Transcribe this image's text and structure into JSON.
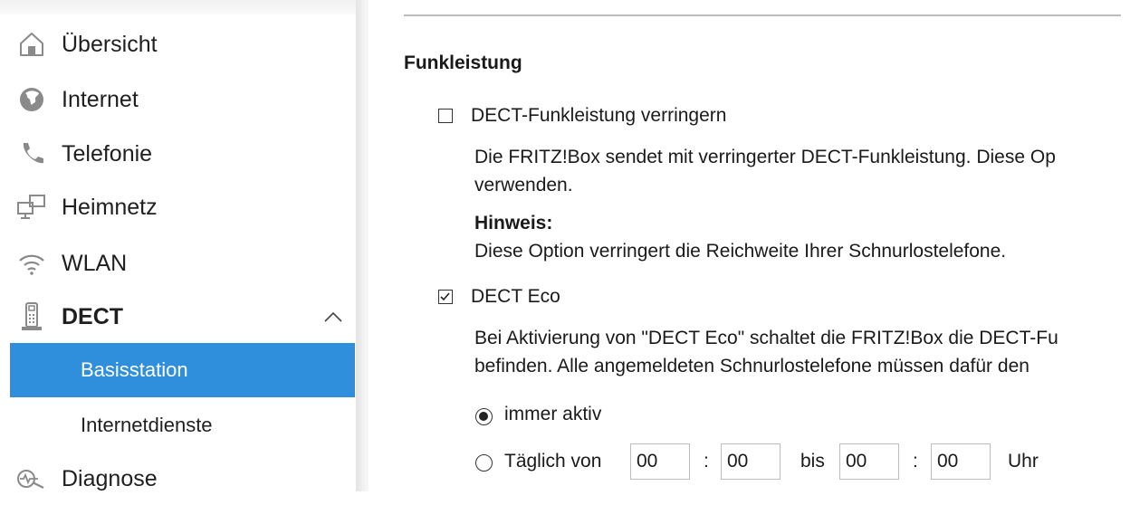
{
  "sidebar": {
    "items": [
      {
        "label": "Übersicht",
        "icon": "home-icon"
      },
      {
        "label": "Internet",
        "icon": "globe-icon"
      },
      {
        "label": "Telefonie",
        "icon": "phone-icon"
      },
      {
        "label": "Heimnetz",
        "icon": "network-icon"
      },
      {
        "label": "WLAN",
        "icon": "wifi-icon"
      },
      {
        "label": "DECT",
        "icon": "dect-handset-icon",
        "expanded": true
      },
      {
        "label": "Diagnose",
        "icon": "diagnose-icon"
      }
    ],
    "dect_subitems": [
      {
        "label": "Basisstation",
        "active": true
      },
      {
        "label": "Internetdienste",
        "active": false
      }
    ],
    "accent_color": "#2f8fdc"
  },
  "main": {
    "section_title": "Funkleistung",
    "option_reduce": {
      "label": "DECT-Funkleistung verringern",
      "checked": false,
      "description_line1": "Die FRITZ!Box sendet mit verringerter DECT-Funkleistung. Diese Op",
      "description_line2": "verwenden.",
      "hint_title": "Hinweis:",
      "hint_text": "Diese Option verringert die Reichweite Ihrer Schnurlostelefone."
    },
    "option_eco": {
      "label": "DECT Eco",
      "checked": true,
      "description_line1": "Bei Aktivierung von \"DECT Eco\" schaltet die FRITZ!Box die DECT-Fu",
      "description_line2": "befinden. Alle angemeldeten Schnurlostelefone müssen dafür den"
    },
    "radio_always": {
      "label": "immer aktiv",
      "checked": true
    },
    "radio_daily": {
      "label": "Täglich von",
      "checked": false,
      "from_hour": "00",
      "colon1": ":",
      "from_minute": "00",
      "bis_label": "bis",
      "to_hour": "00",
      "colon2": ":",
      "to_minute": "00",
      "unit_label": "Uhr"
    }
  }
}
